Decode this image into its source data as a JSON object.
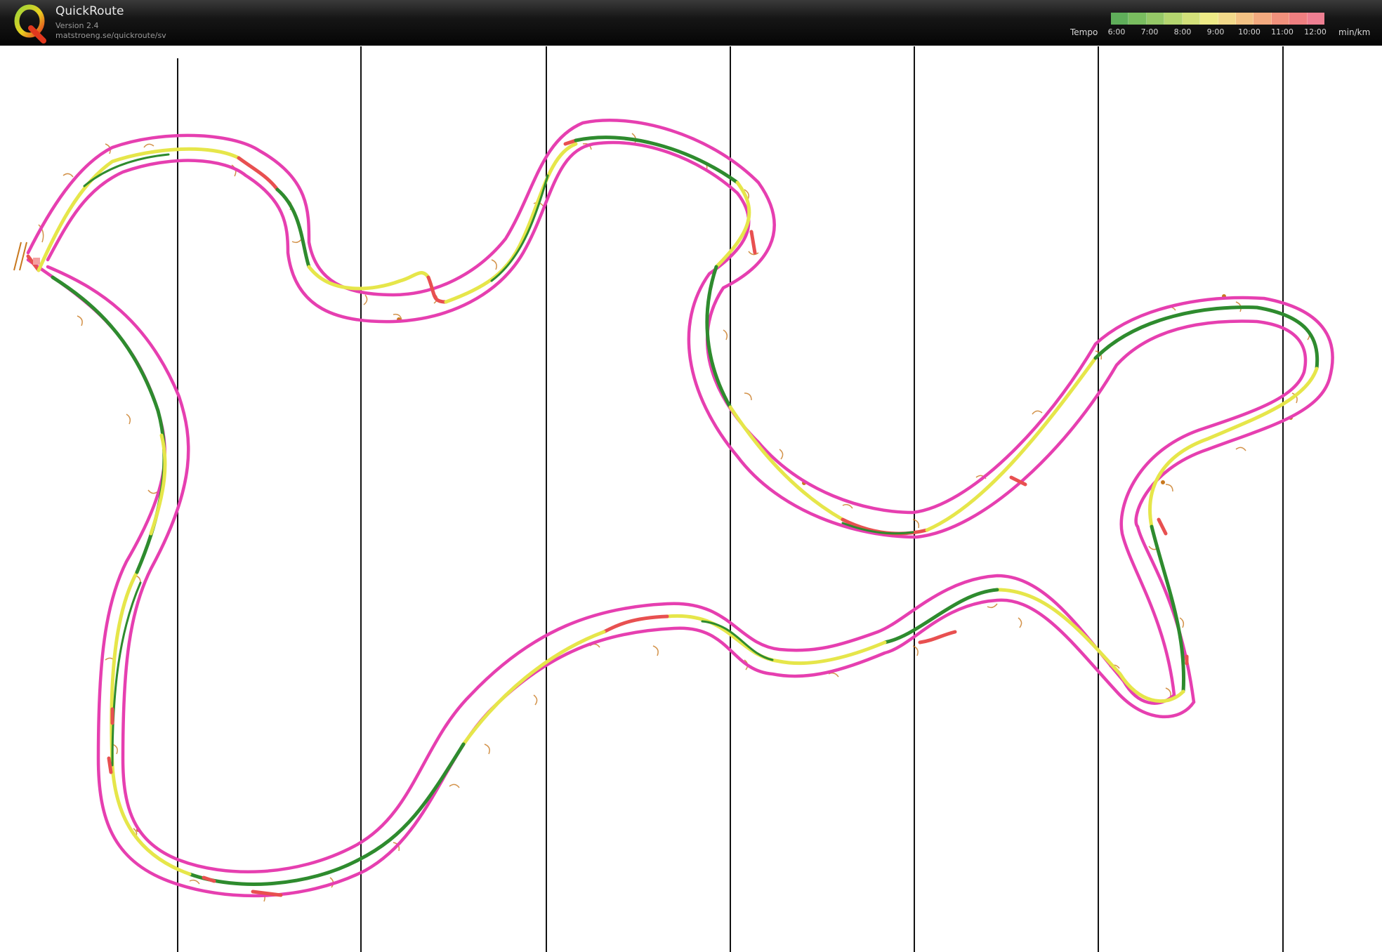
{
  "header": {
    "app_name": "QuickRoute",
    "version": "Version 2.4",
    "url": "matstroeng.se/quickroute/sv"
  },
  "legend": {
    "title": "Tempo",
    "unit": "min/km",
    "ticks": [
      "6:00",
      "7:00",
      "8:00",
      "9:00",
      "10:00",
      "11:00",
      "12:00"
    ],
    "gradient_colors": [
      "#5fae5a",
      "#79bd5f",
      "#95c867",
      "#b4d56f",
      "#d2e07a",
      "#eeea86",
      "#f2d98a",
      "#f3c284",
      "#f3aa7f",
      "#f1917c",
      "#ef7f80",
      "#ee7f92"
    ]
  },
  "map": {
    "course_color": "#e63fb0",
    "route_colors": {
      "fast": "#2e8b2e",
      "medium": "#e6e64a",
      "slow": "#e85050"
    },
    "feature_color": "#c8781e",
    "grid_color": "#111111"
  }
}
